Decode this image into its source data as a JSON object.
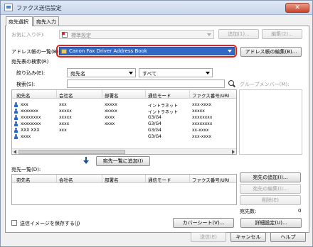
{
  "window": {
    "title": "ファクス送信設定",
    "close_glyph": "✕"
  },
  "tabs": [
    {
      "label": "宛先選択"
    },
    {
      "label": "宛先入力"
    }
  ],
  "favorites": {
    "label": "お気に入り(F):",
    "value": "標準設定",
    "add": "追加(1)...",
    "edit": "編集(2)..."
  },
  "addressbook": {
    "label": "アドレス帳の一覧(B):",
    "value": "Canon Fax Driver Address Book",
    "edit": "アドレス帳の編集(B)..."
  },
  "search": {
    "section": "宛先表の検索(R)",
    "filter_label": "絞り込み(E):",
    "filter_field": "宛先名",
    "filter_value": "すべて",
    "search_label": "検索(S):",
    "search_value": ""
  },
  "group_label": "グループメンバー(M):",
  "table": {
    "columns": [
      "宛先名",
      "会社名",
      "部署名",
      "通信モード",
      "ファクス番号/URI"
    ],
    "rows": [
      [
        "xxx",
        "xxx",
        "xxxxx",
        "イントラネット",
        "xxx-xxxx"
      ],
      [
        "xxxxxxx",
        "xxxxx",
        "xxxxx",
        "イントラネット",
        "xxxxx"
      ],
      [
        "xxxxxxxx",
        "xxxxx",
        "xxxx",
        "G3/G4",
        "xxxxxxxx"
      ],
      [
        "xxxxxxxx",
        "xxxx",
        "xxxx",
        "G3/G4",
        "xxxxxxxx"
      ],
      [
        "XXX XXX",
        "xxx",
        "",
        "G3/G4",
        "xx-xxxx"
      ],
      [
        "xxxx",
        "",
        "",
        "G3/G4",
        "xxx-xxxx"
      ]
    ]
  },
  "add_to_list": "宛先一覧に追加(I)",
  "dest_list": {
    "label": "宛先一覧(D):",
    "columns": [
      "宛先名",
      "会社名",
      "部署名",
      "通信モード",
      "ファクス番号/URI"
    ]
  },
  "dest_buttons": {
    "add": "宛先の追加(I)...",
    "edit": "宛先の編集(I)...",
    "delete": "削除(E)"
  },
  "dest_count": {
    "label": "宛先数:",
    "value": "0"
  },
  "save_image": {
    "label": "送信イメージを保存する(J)"
  },
  "coversheet": "カバーシート(V)...",
  "details": "詳細設定(U)...",
  "footer": {
    "send": "送信(E)",
    "cancel": "キャンセル",
    "help": "ヘルプ"
  }
}
